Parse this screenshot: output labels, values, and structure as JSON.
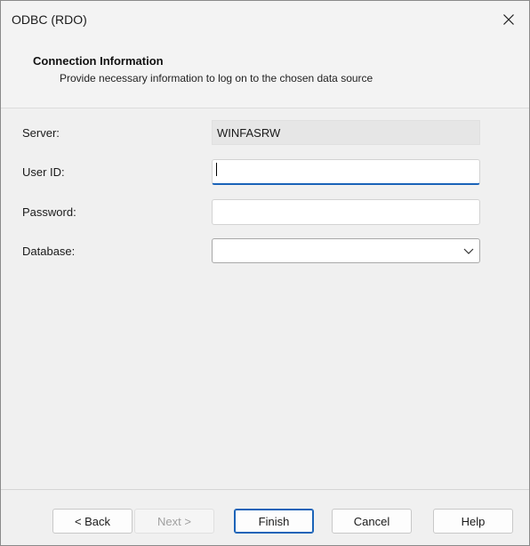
{
  "window": {
    "title": "ODBC (RDO)",
    "close_icon": "close-icon"
  },
  "header": {
    "title": "Connection Information",
    "subtitle": "Provide necessary information to log on to the chosen data source"
  },
  "form": {
    "server": {
      "label": "Server:",
      "value": "WINFASRW"
    },
    "user_id": {
      "label": "User ID:",
      "value": "",
      "placeholder": ""
    },
    "password": {
      "label": "Password:",
      "value": "",
      "placeholder": ""
    },
    "database": {
      "label": "Database:",
      "selected": "",
      "icon": "chevron-down-icon"
    }
  },
  "footer": {
    "back_label": "< Back",
    "next_label": "Next >",
    "finish_label": "Finish",
    "cancel_label": "Cancel",
    "help_label": "Help"
  },
  "colors": {
    "accent": "#1a63b8",
    "window_bg": "#f0f0f0",
    "disabled_text": "#a0a0a0"
  }
}
